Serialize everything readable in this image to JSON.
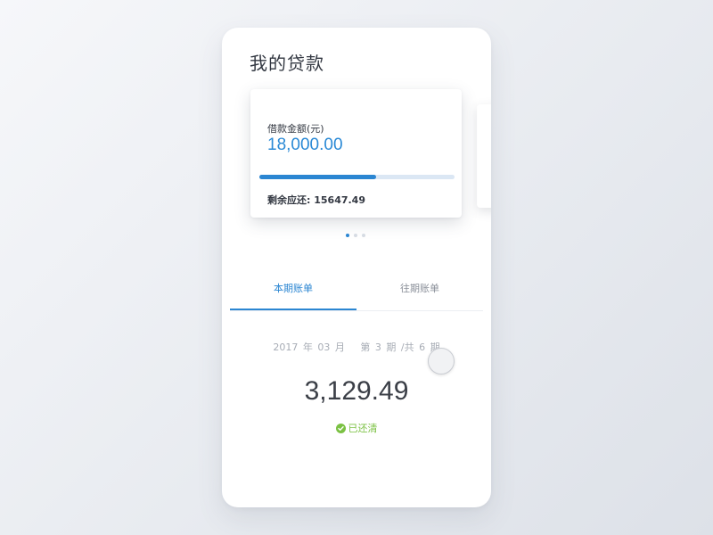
{
  "page": {
    "title": "我的贷款"
  },
  "loan_card": {
    "label": "借款金额(元)",
    "amount": "18,000.00",
    "progress_fraction": 0.6,
    "remaining": "剩余应还: 15647.49"
  },
  "carousel": {
    "page_count": 3,
    "active_index": 0
  },
  "tabs": [
    {
      "label": "本期账单",
      "active": true
    },
    {
      "label": "往期账单",
      "active": false
    }
  ],
  "bill": {
    "period_date": "2017 年 03 月",
    "period_term": "第 3 期 /共 6 期",
    "amount": "3,129.49",
    "status": "已还清"
  },
  "colors": {
    "accent": "#2b86d2",
    "success": "#7bc143"
  },
  "icons": {
    "status": "check-circle-icon"
  }
}
